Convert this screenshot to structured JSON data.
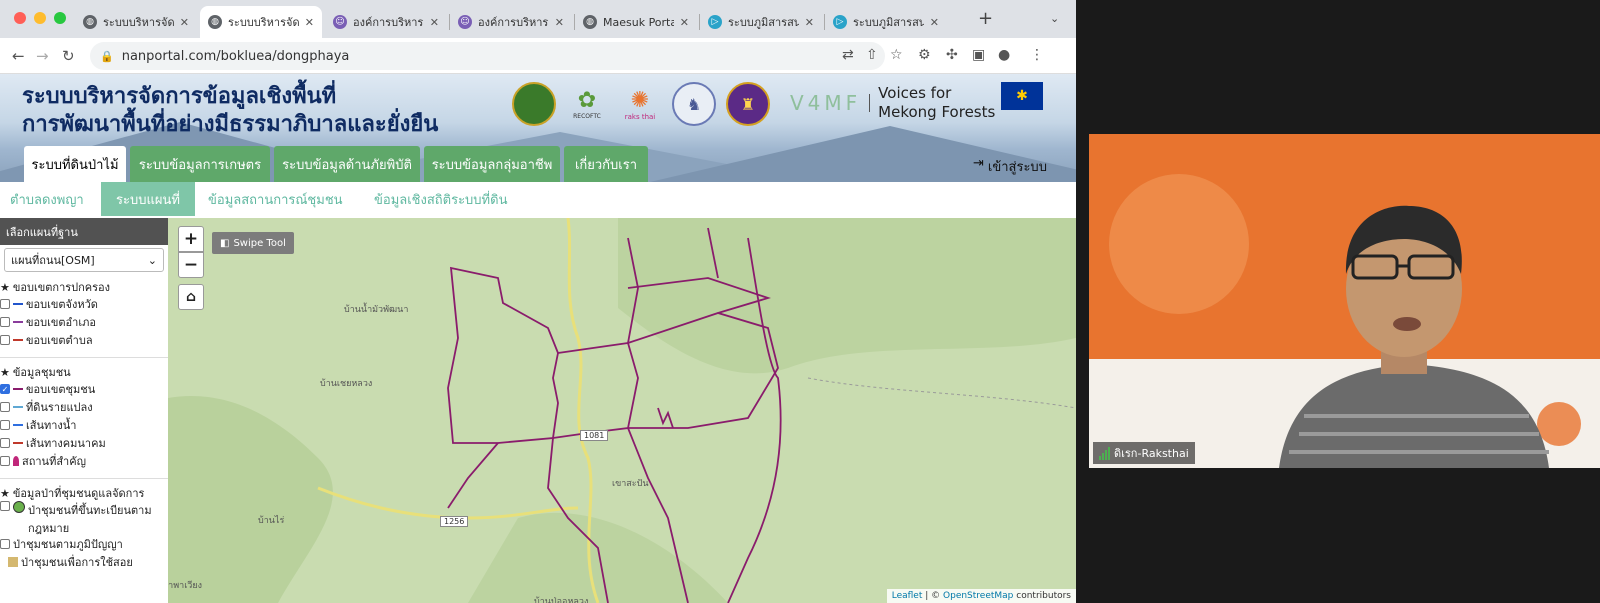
{
  "browser": {
    "tabs": [
      {
        "label": "ระบบบริหารจัดก",
        "icon": "globe-icon",
        "active": false
      },
      {
        "label": "ระบบบริหารจัดก",
        "icon": "globe-icon",
        "active": true
      },
      {
        "label": "องค์การบริหารส่",
        "icon": "site-icon",
        "active": false
      },
      {
        "label": "องค์การบริหารส่",
        "icon": "site-icon",
        "active": false
      },
      {
        "label": "Maesuk Portal",
        "icon": "globe-icon",
        "active": false
      },
      {
        "label": "ระบบภูมิสารสนเ",
        "icon": "bing-icon",
        "active": false
      },
      {
        "label": "ระบบภูมิสารสนเ",
        "icon": "bing-icon",
        "active": false
      }
    ],
    "new_tab": "+",
    "tab_menu": "⌄",
    "url": "nanportal.com/bokluea/dongphaya"
  },
  "header": {
    "title_line1": "ระบบบริหารจัดการข้อมูลเชิงพื้นที่",
    "title_line2": "การพัฒนาพื้นที่อย่างมีธรรมาภิบาลและยั่งยืน",
    "recoftc_label": "RECOFTC",
    "raksthai_label": "raks thai",
    "v4mf_mark": "V4MF",
    "v4mf_text_line1": "Voices for",
    "v4mf_text_line2": "Mekong Forests"
  },
  "main_nav": {
    "tabs": [
      "ระบบที่ดินป่าไม้",
      "ระบบข้อมูลการเกษตร",
      "ระบบข้อมูลด้านภัยพิบัติ",
      "ระบบข้อมูลกลุ่มอาชีพ",
      "เกี่ยวกับเรา"
    ],
    "login": "เข้าสู่ระบบ"
  },
  "sub_nav": {
    "tabs": [
      "ตำบลดงพญา",
      "ระบบแผนที่",
      "ข้อมูลสถานการณ์ชุมชน",
      "ข้อมูลเชิงสถิติระบบที่ดิน"
    ],
    "active_index": 1
  },
  "sidebar": {
    "header": "เลือกแผนที่ฐาน",
    "base_map": "แผนที่ถนน[OSM]",
    "admin_title": "ขอบเขตการปกครอง",
    "admin_items": [
      {
        "label": "ขอบเขตจังหวัด",
        "color": "#2255cc"
      },
      {
        "label": "ขอบเขตอำเภอ",
        "color": "#8a3c9c"
      },
      {
        "label": "ขอบเขตตำบล",
        "color": "#c0392b"
      }
    ],
    "community_title": "ข้อมูลชุมชน",
    "community_items": [
      {
        "label": "ขอบเขตชุมชน",
        "color": "#8a1c6c",
        "checked": true
      },
      {
        "label": "ที่ดินรายแปลง",
        "color": "#5fa8d3",
        "checked": false
      },
      {
        "label": "เส้นทางน้ำ",
        "color": "#2f6fe0",
        "checked": false
      },
      {
        "label": "เส้นทางคมนาคม",
        "color": "#c0392b",
        "checked": false
      },
      {
        "label": "สถานที่สำคัญ",
        "color": "#c0267a",
        "checked": false
      }
    ],
    "forest_title": "ข้อมูลป่าที่ชุมชนดูแลจัดการ",
    "forest_items": [
      "ป่าชุมชนที่ขึ้นทะเบียนตามกฎหมาย",
      "ป่าชุมชนตามภูมิปัญญา",
      "ป่าชุมชนเพื่อการใช้สอย"
    ]
  },
  "map": {
    "zoom_in": "+",
    "zoom_out": "−",
    "swipe_tool": "Swipe Tool",
    "labels": [
      "บ้านน้ำมัวพัฒนา",
      "บ้านเชยหลวง",
      "บ้านไร่",
      "นาพาเวียง",
      "เขาสะปัน",
      "บ้านป่ออหลวง"
    ],
    "road_shields": [
      "1081",
      "1256"
    ],
    "attribution": {
      "leaflet": "Leaflet",
      "sep": " | © ",
      "osm": "OpenStreetMap",
      "rest": " contributors"
    }
  },
  "video": {
    "participant_name": "ดิเรก-Raksthai"
  },
  "colors": {
    "nav_green": "#5fa86a",
    "subnav_active": "#7fc6a8",
    "boundary": "#8a1c6c",
    "video_bg": "#e8742f"
  }
}
